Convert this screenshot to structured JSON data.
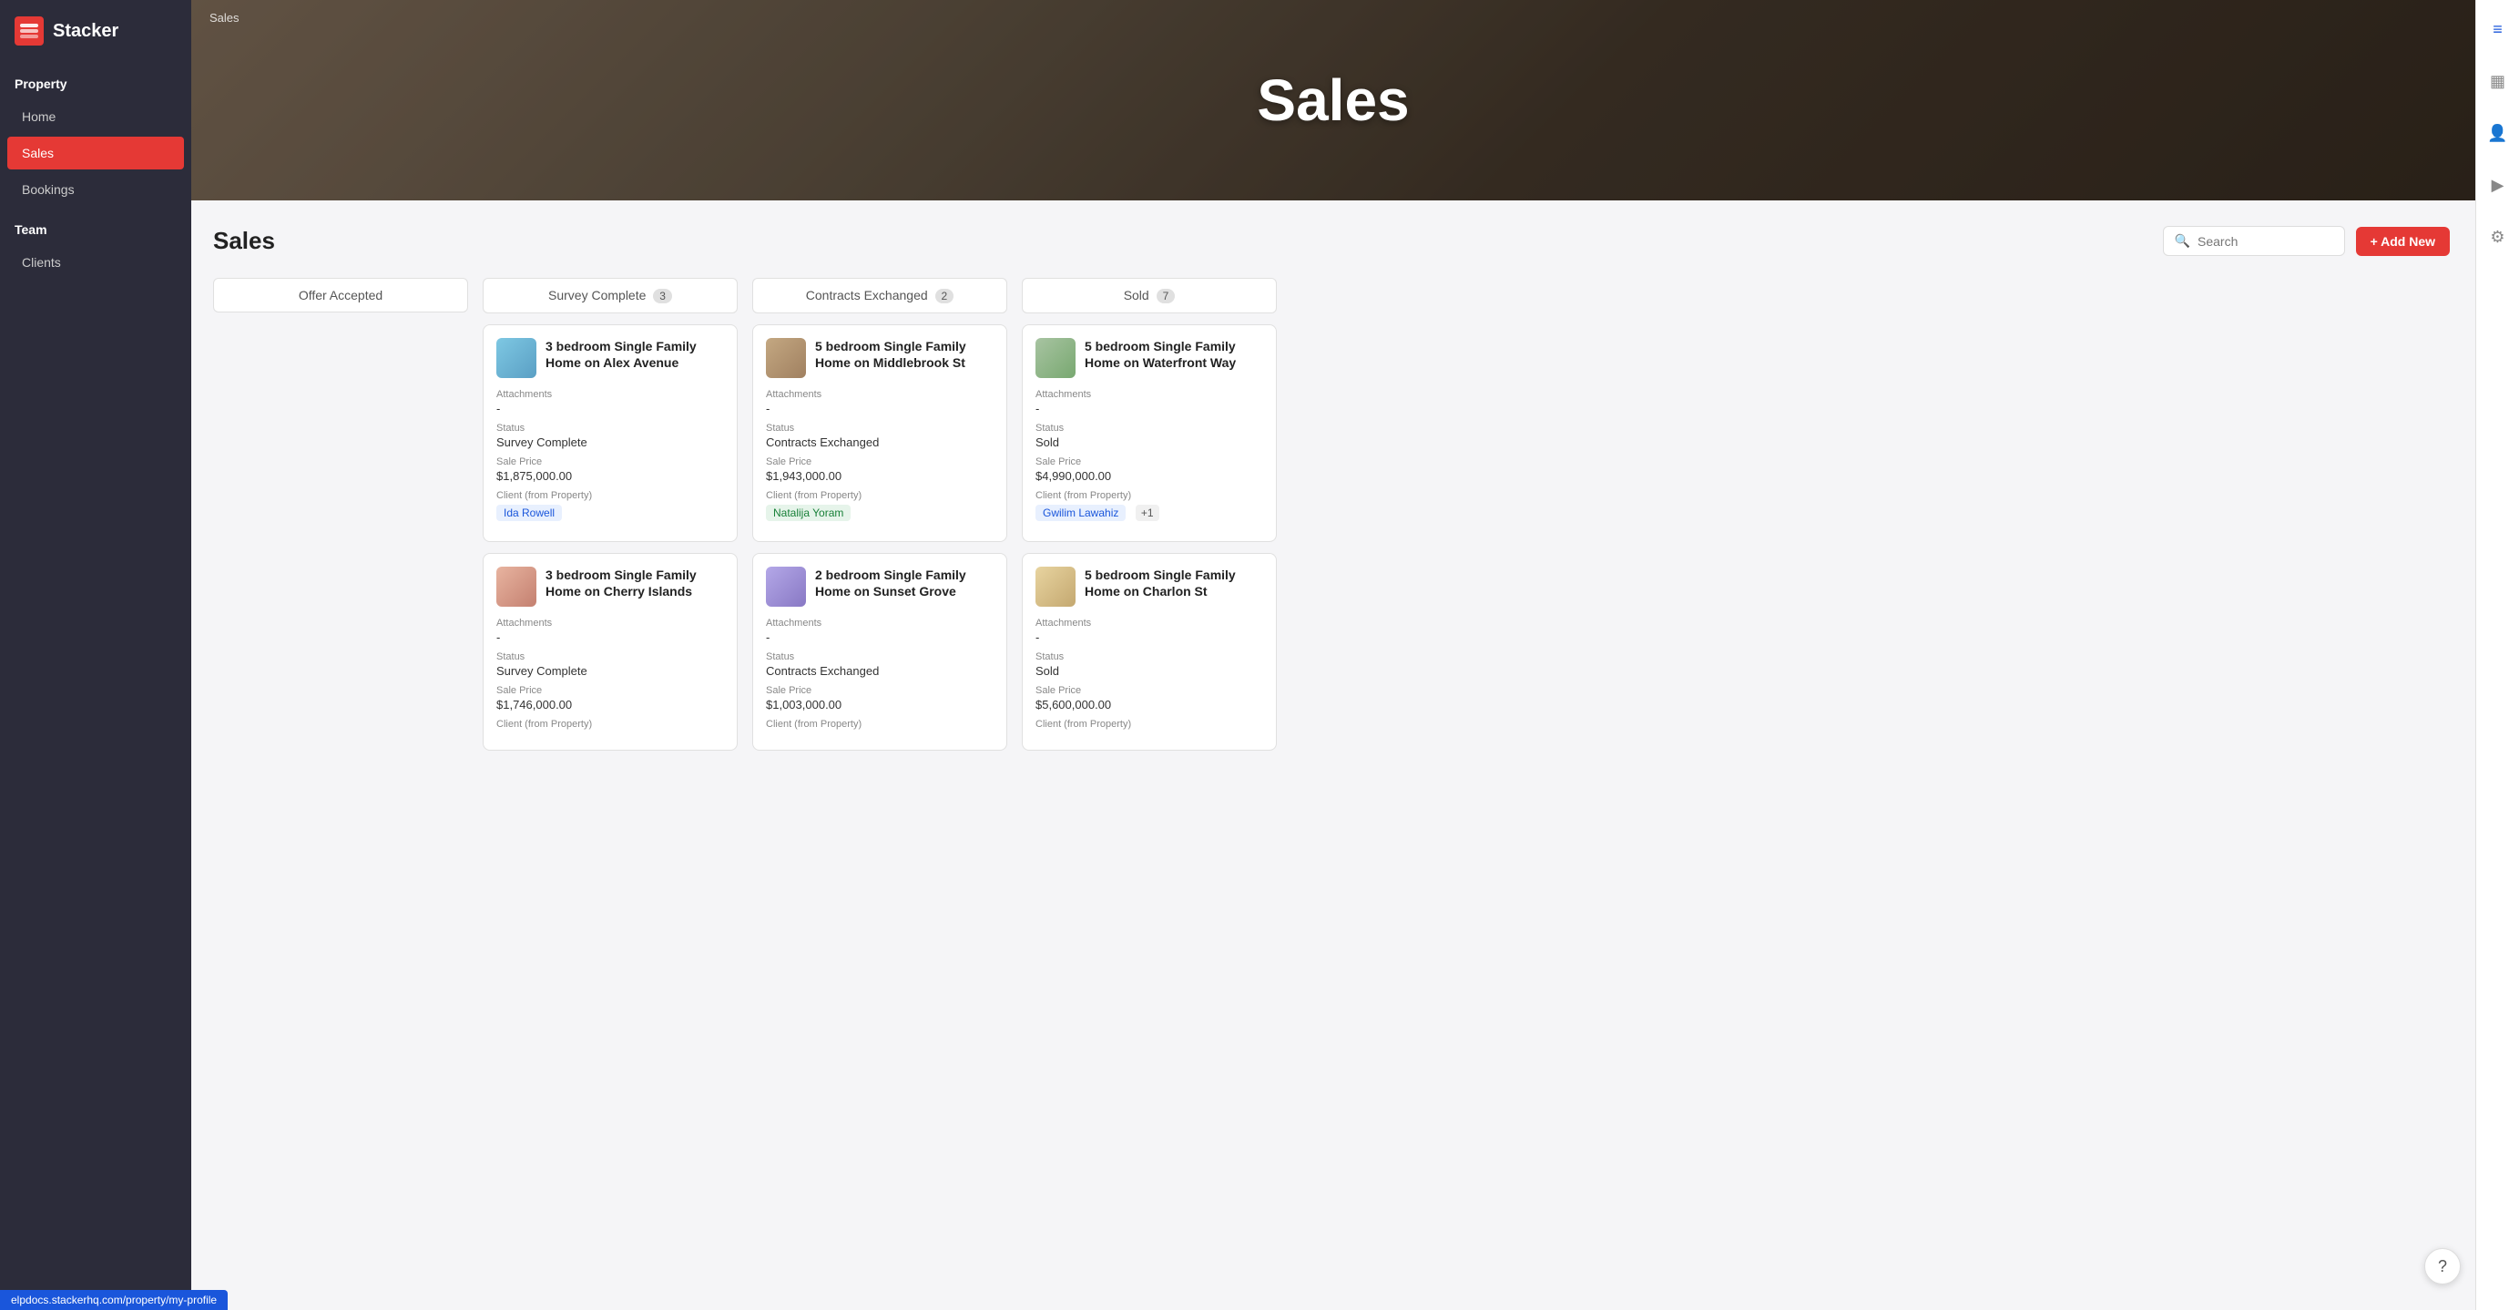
{
  "app": {
    "name": "Stacker"
  },
  "sidebar": {
    "property_section": "Property",
    "items": [
      {
        "id": "home",
        "label": "Home",
        "active": false
      },
      {
        "id": "sales",
        "label": "Sales",
        "active": true
      },
      {
        "id": "bookings",
        "label": "Bookings",
        "active": false
      }
    ],
    "team_section": "Team",
    "team_items": [
      {
        "id": "clients",
        "label": "Clients",
        "active": false
      }
    ]
  },
  "hero": {
    "breadcrumb": "Sales",
    "title": "Sales"
  },
  "content": {
    "title": "Sales",
    "search_placeholder": "Search",
    "add_button": "+ Add New"
  },
  "columns": [
    {
      "id": "offer-accepted",
      "label": "Offer Accepted",
      "badge": null,
      "cards": []
    },
    {
      "id": "survey-complete",
      "label": "Survey Complete",
      "badge": "3",
      "cards": [
        {
          "id": "card-alex",
          "thumb_class": "thumb-alex",
          "title": "3 bedroom Single Family Home on Alex Avenue",
          "attachments_label": "Attachments",
          "attachments_value": "-",
          "status_label": "Status",
          "status_value": "Survey Complete",
          "price_label": "Sale Price",
          "price_value": "$1,875,000.00",
          "client_label": "Client (from Property)",
          "client_tags": [
            "Ida Rowell"
          ],
          "extra_count": null
        },
        {
          "id": "card-cherry",
          "thumb_class": "thumb-cherry",
          "title": "3 bedroom Single Family Home on Cherry Islands",
          "attachments_label": "Attachments",
          "attachments_value": "-",
          "status_label": "Status",
          "status_value": "Survey Complete",
          "price_label": "Sale Price",
          "price_value": "$1,746,000.00",
          "client_label": "Client (from Property)",
          "client_tags": [],
          "extra_count": null
        }
      ]
    },
    {
      "id": "contracts-exchanged",
      "label": "Contracts Exchanged",
      "badge": "2",
      "cards": [
        {
          "id": "card-middlebrook",
          "thumb_class": "thumb-middlebrook",
          "title": "5 bedroom Single Family Home on Middlebrook St",
          "attachments_label": "Attachments",
          "attachments_value": "-",
          "status_label": "Status",
          "status_value": "Contracts Exchanged",
          "price_label": "Sale Price",
          "price_value": "$1,943,000.00",
          "client_label": "Client (from Property)",
          "client_tags": [
            "Natalija Yoram"
          ],
          "extra_count": null
        },
        {
          "id": "card-sunset",
          "thumb_class": "thumb-sunset",
          "title": "2 bedroom Single Family Home on Sunset Grove",
          "attachments_label": "Attachments",
          "attachments_value": "-",
          "status_label": "Status",
          "status_value": "Contracts Exchanged",
          "price_label": "Sale Price",
          "price_value": "$1,003,000.00",
          "client_label": "Client (from Property)",
          "client_tags": [],
          "extra_count": null
        }
      ]
    },
    {
      "id": "sold",
      "label": "Sold",
      "badge": "7",
      "cards": [
        {
          "id": "card-waterfront",
          "thumb_class": "thumb-waterfront",
          "title": "5 bedroom Single Family Home on Waterfront Way",
          "attachments_label": "Attachments",
          "attachments_value": "-",
          "status_label": "Status",
          "status_value": "Sold",
          "price_label": "Sale Price",
          "price_value": "$4,990,000.00",
          "client_label": "Client (from Property)",
          "client_tags": [
            "Gwilim Lawahiz"
          ],
          "extra_count": "+1"
        },
        {
          "id": "card-charlon",
          "thumb_class": "thumb-charlon",
          "title": "5 bedroom Single Family Home on Charlon St",
          "attachments_label": "Attachments",
          "attachments_value": "-",
          "status_label": "Status",
          "status_value": "Sold",
          "price_label": "Sale Price",
          "price_value": "$5,600,000.00",
          "client_label": "Client (from Property)",
          "client_tags": [],
          "extra_count": null
        }
      ]
    }
  ],
  "toolbar_icons": [
    {
      "id": "filter-icon",
      "symbol": "≡",
      "active": true
    },
    {
      "id": "calendar-icon",
      "symbol": "▦",
      "active": false
    },
    {
      "id": "person-icon",
      "symbol": "👤",
      "active": false
    },
    {
      "id": "play-icon",
      "symbol": "▶",
      "active": false
    },
    {
      "id": "settings-icon",
      "symbol": "⚙",
      "active": false
    }
  ],
  "url": "elpdocs.stackerhq.com/property/my-profile",
  "help_button": "?"
}
